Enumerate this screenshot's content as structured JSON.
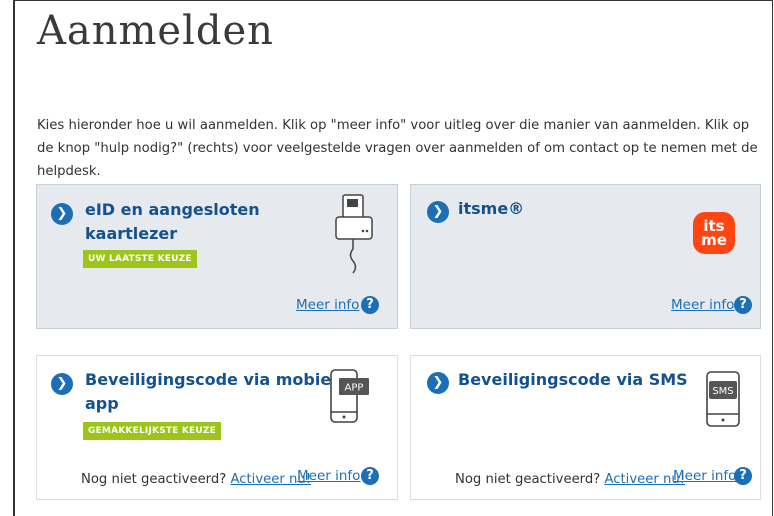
{
  "page": {
    "title": "Aanmelden",
    "intro": "Kies hieronder hoe u wil aanmelden. Klik op \"meer info\" voor uitleg over die manier van aanmelden. Klik op de knop \"hulp nodig?\" (rechts) voor veelgestelde vragen over aanmelden of om contact op te nemen met de helpdesk."
  },
  "options": [
    {
      "title_line1": "eID en aangesloten",
      "title_line2": "kaartlezer",
      "badge": "UW LAATSTE KEUZE",
      "more_info": "Meer info",
      "icon": "card-reader-icon"
    },
    {
      "title_line1": "itsme®",
      "logo_line1": "its",
      "logo_line2": "me",
      "more_info": "Meer info",
      "icon": "itsme-logo"
    },
    {
      "title_line1": "Beveiligingscode via mobiele",
      "title_line2": "app",
      "badge": "GEMAKKELIJKSTE KEUZE",
      "not_activated": "Nog niet geactiveerd?",
      "activate": "Activeer nu!",
      "more_info": "Meer info",
      "icon_label": "APP",
      "icon": "phone-app-icon"
    },
    {
      "title_line1": "Beveiligingscode via SMS",
      "not_activated": "Nog niet geactiveerd?",
      "activate": "Activeer nu!",
      "more_info": "Meer info",
      "icon_label": "SMS",
      "icon": "phone-sms-icon"
    }
  ],
  "colors": {
    "accent": "#1c6fb5",
    "title_blue": "#15518c",
    "badge_green": "#9cc41a",
    "card_grey": "#e6eaee",
    "itsme_orange": "#ff4612"
  }
}
